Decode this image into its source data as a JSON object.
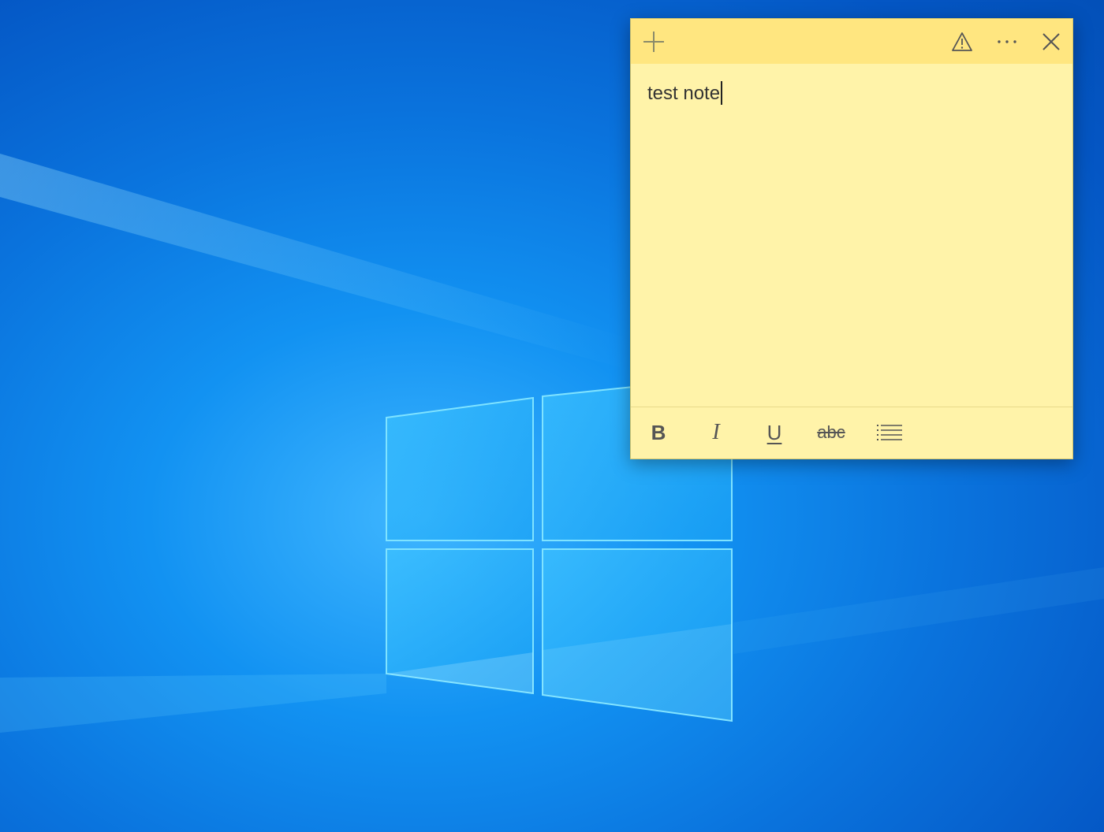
{
  "colors": {
    "note_background": "#fff3a9",
    "note_titlebar": "#ffe680",
    "icon_color": "#555555",
    "desktop_accent": "#0a73dd"
  },
  "note": {
    "toolbar": {
      "add_icon": "plus-icon",
      "alert_icon": "warning-triangle-icon",
      "menu_icon": "more-ellipsis-icon",
      "close_icon": "close-icon"
    },
    "content": "test note",
    "format": {
      "bold_label": "B",
      "italic_label": "I",
      "underline_label": "U",
      "strikethrough_label": "abc",
      "bullets_icon": "bullet-list-icon"
    }
  },
  "desktop": {
    "wallpaper": "windows-10-logo-light"
  }
}
